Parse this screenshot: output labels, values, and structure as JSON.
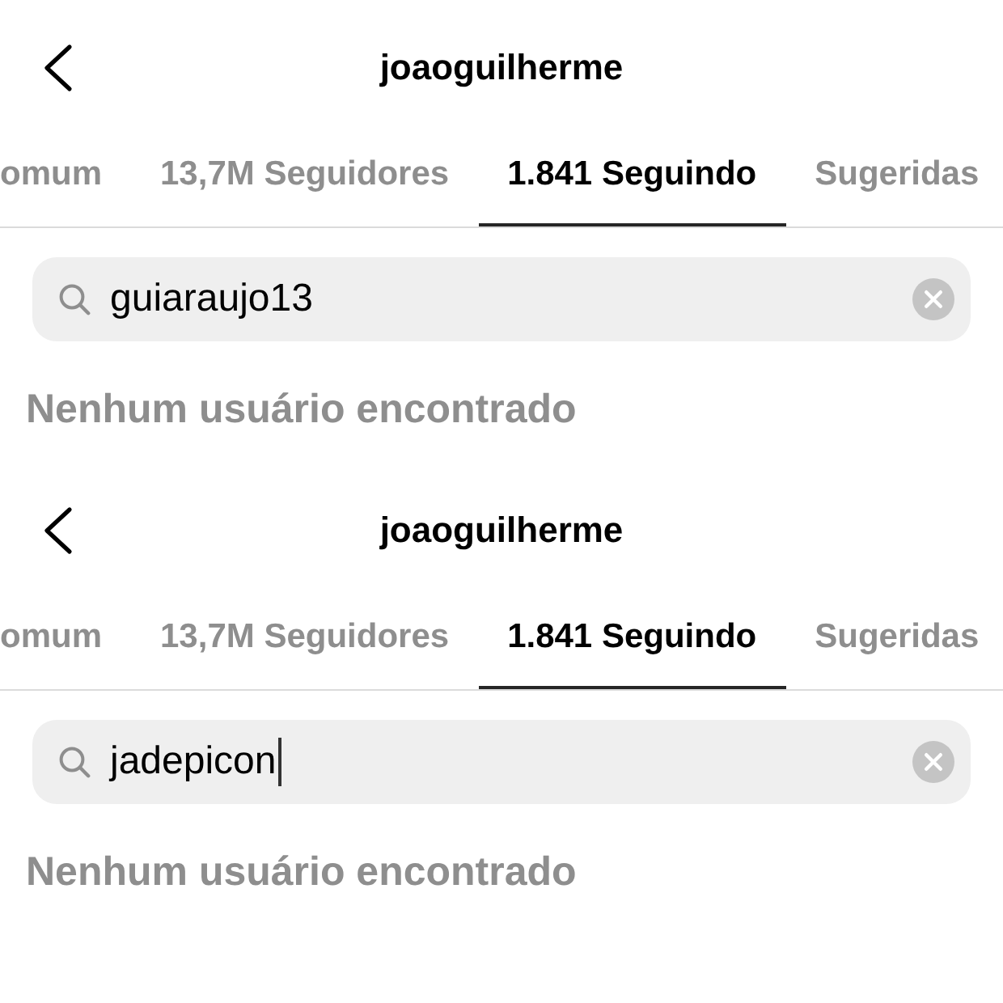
{
  "panels": [
    {
      "header": {
        "title": "joaoguilherme"
      },
      "tabs": [
        {
          "label": "omum",
          "selected": false
        },
        {
          "label": "13,7M Seguidores",
          "selected": false
        },
        {
          "label": "1.841 Seguindo",
          "selected": true
        },
        {
          "label": "Sugeridas",
          "selected": false
        }
      ],
      "search": {
        "value": "guiaraujo13",
        "focused": false
      },
      "empty_message": "Nenhum usuário encontrado"
    },
    {
      "header": {
        "title": "joaoguilherme"
      },
      "tabs": [
        {
          "label": "omum",
          "selected": false
        },
        {
          "label": "13,7M Seguidores",
          "selected": false
        },
        {
          "label": "1.841 Seguindo",
          "selected": true
        },
        {
          "label": "Sugeridas",
          "selected": false
        }
      ],
      "search": {
        "value": "jadepicon",
        "focused": true
      },
      "empty_message": "Nenhum usuário encontrado"
    }
  ]
}
